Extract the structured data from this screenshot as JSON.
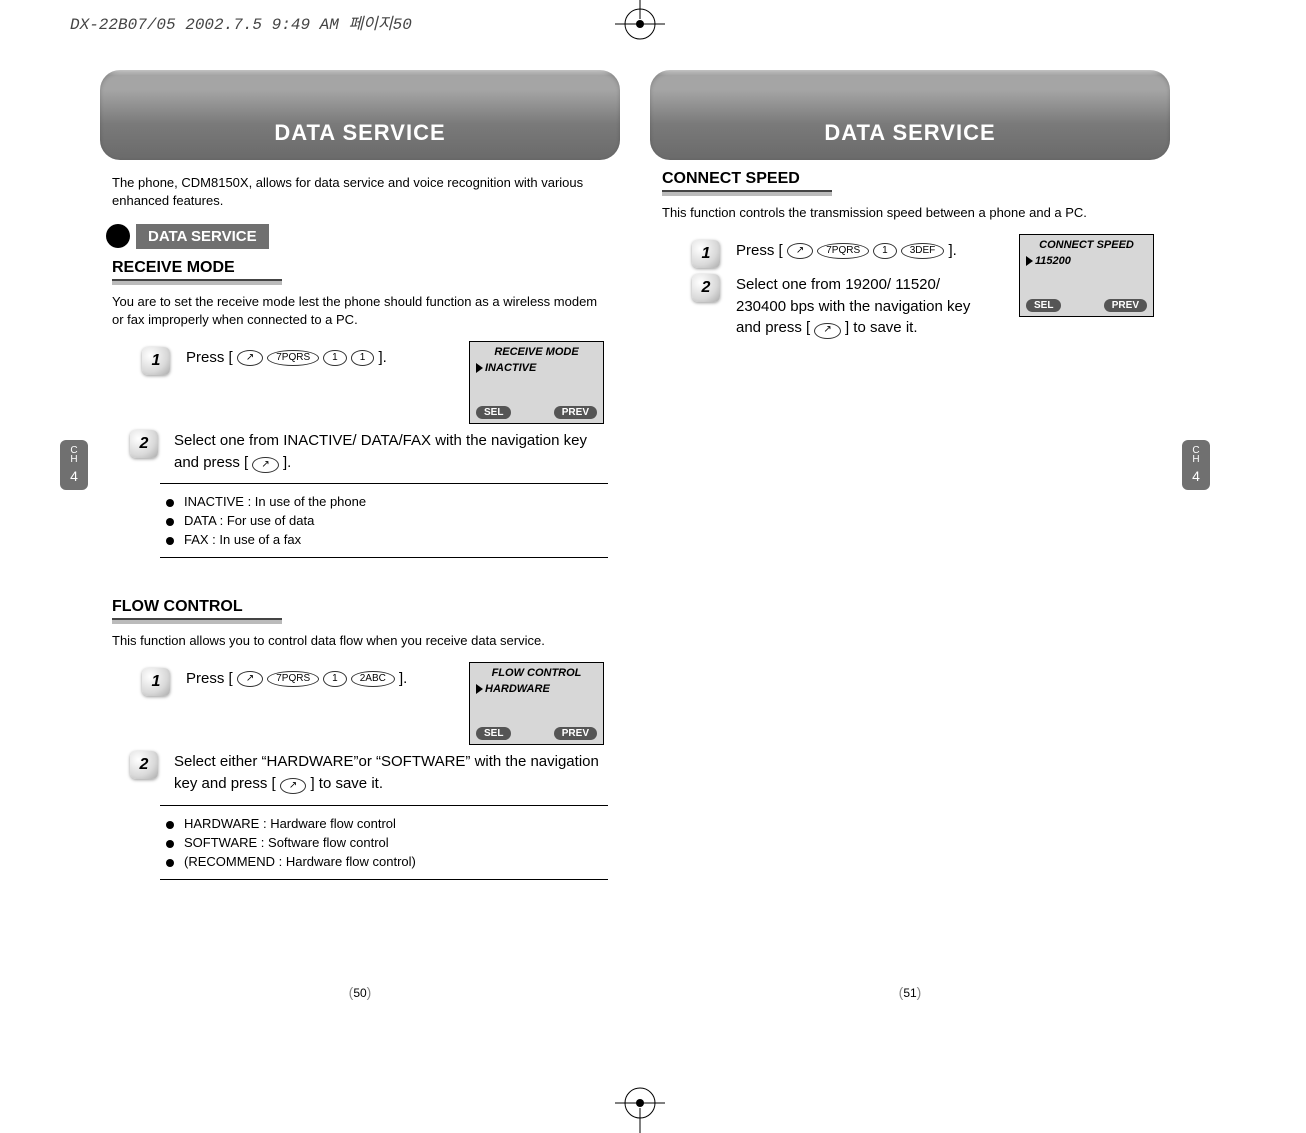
{
  "file_header": "DX-22B07/05  2002.7.5 9:49 AM  페이지50",
  "side_tab": {
    "ch_label": "C\nH",
    "num": "4"
  },
  "page_numbers": {
    "left": "50",
    "right": "51"
  },
  "screen_buttons": {
    "sel": "SEL",
    "prev": "PREV"
  },
  "left_page": {
    "banner": "DATA  SERVICE",
    "intro": "The phone, CDM8150X, allows for data service and voice recognition with various enhanced features.",
    "chip": "DATA SERVICE",
    "receive_mode": {
      "title": "RECEIVE MODE",
      "desc": "You are to set the receive mode lest the phone should function as a wireless modem or fax improperly when connected to a PC.",
      "step1_label": "1",
      "step1_prefix": "Press [",
      "step1_keys": [
        "↗",
        "7PQRS",
        "1",
        "1"
      ],
      "step1_suffix": "].",
      "screen_title": "RECEIVE MODE",
      "screen_item": "INACTIVE",
      "step2_label": "2",
      "step2_text_a": "Select one from INACTIVE/ DATA/FAX with the navigation key and press [ ",
      "step2_key": "↗",
      "step2_text_b": " ].",
      "notes": [
        "INACTIVE : In use of the phone",
        "DATA : For use of data",
        "FAX : In use of a fax"
      ]
    },
    "flow_control": {
      "title": "FLOW  CONTROL",
      "desc": "This function allows you to control data flow when you receive data service.",
      "step1_label": "1",
      "step1_prefix": "Press [",
      "step1_keys": [
        "↗",
        "7PQRS",
        "1",
        "2ABC"
      ],
      "step1_suffix": "].",
      "screen_title": "FLOW CONTROL",
      "screen_item": "HARDWARE",
      "step2_label": "2",
      "step2_text_a": "Select either “HARDWARE”or “SOFTWARE” with the navigation key and press [ ",
      "step2_key": "↗",
      "step2_text_b": " ] to save it.",
      "notes": [
        "HARDWARE : Hardware flow control",
        "SOFTWARE : Software flow control",
        "(RECOMMEND : Hardware flow control)"
      ]
    }
  },
  "right_page": {
    "banner": "DATA  SERVICE",
    "connect_speed": {
      "title": "CONNECT SPEED",
      "desc": "This function controls the transmission speed between a phone and a PC.",
      "step1_label": "1",
      "step1_prefix": "Press [",
      "step1_keys": [
        "↗",
        "7PQRS",
        "1",
        "3DEF"
      ],
      "step1_suffix": "].",
      "screen_title": "CONNECT SPEED",
      "screen_item": "115200",
      "step2_label": "2",
      "step2_text_a": "Select one from 19200/ 11520/ 230400 bps with the navigation key and press [ ",
      "step2_key": "↗",
      "step2_text_b": " ] to save it."
    }
  }
}
